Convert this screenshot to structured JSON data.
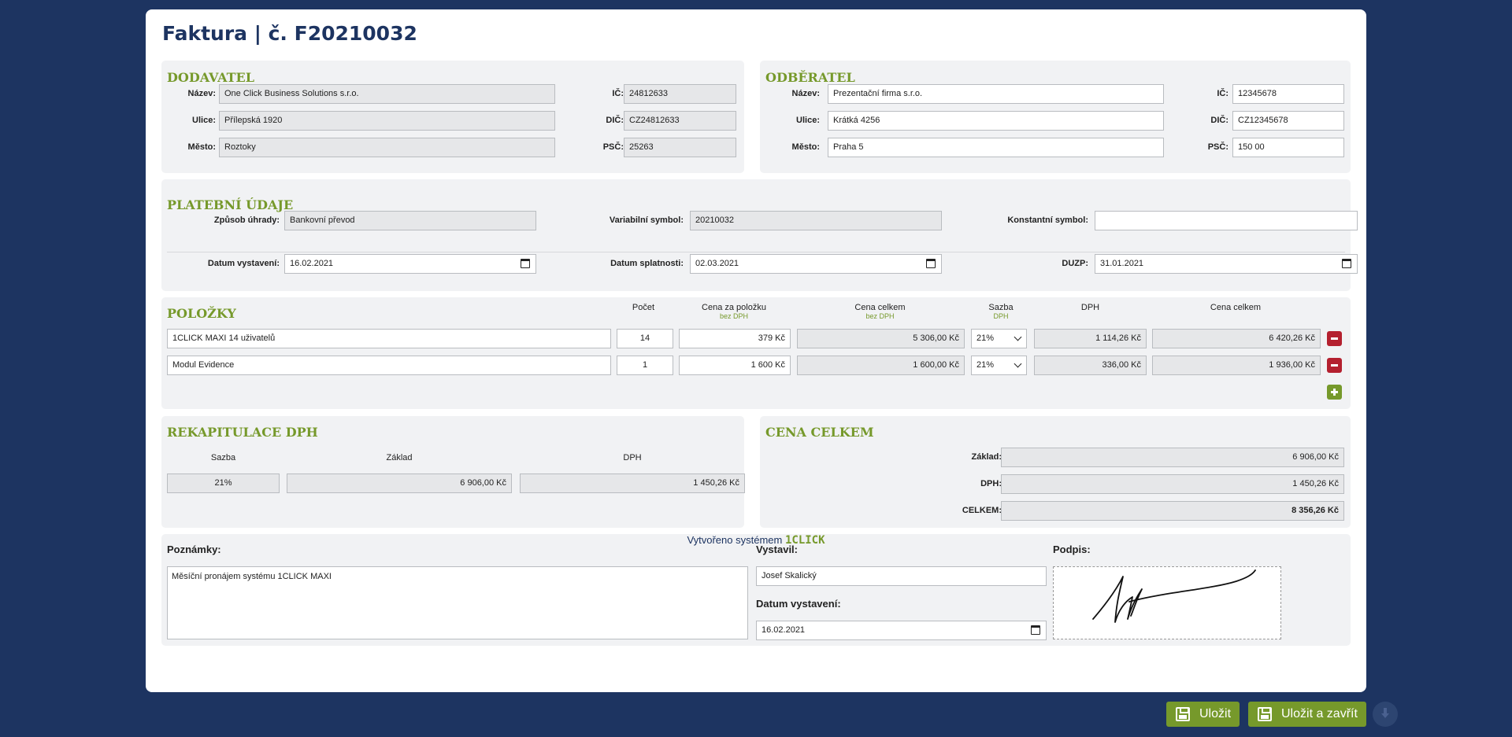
{
  "invoice": {
    "title": "Faktura | č. F20210032"
  },
  "supplier": {
    "heading": "DODAVATEL",
    "name_label": "Název:",
    "name": "One Click Business Solutions s.r.o.",
    "street_label": "Ulice:",
    "street": "Přílepská 1920",
    "city_label": "Město:",
    "city": "Roztoky",
    "ic_label": "IČ:",
    "ic": "24812633",
    "dic_label": "DIČ:",
    "dic": "CZ24812633",
    "psc_label": "PSČ:",
    "psc": "25263"
  },
  "customer": {
    "heading": "ODBĚRATEL",
    "name_label": "Název:",
    "name": "Prezentační firma s.r.o.",
    "street_label": "Ulice:",
    "street": "Krátká 4256",
    "city_label": "Město:",
    "city": "Praha 5",
    "ic_label": "IČ:",
    "ic": "12345678",
    "dic_label": "DIČ:",
    "dic": "CZ12345678",
    "psc_label": "PSČ:",
    "psc": "150 00"
  },
  "payment": {
    "heading": "PLATEBNÍ ÚDAJE",
    "method_label": "Způsob úhrady:",
    "method": "Bankovní převod",
    "vs_label": "Variabilní symbol:",
    "vs": "20210032",
    "ks_label": "Konstantní symbol:",
    "ks": "",
    "issue_label": "Datum vystavení:",
    "issue_date": "16.02.2021",
    "due_label": "Datum splatnosti:",
    "due_date": "02.03.2021",
    "duzp_label": "DUZP:",
    "duzp": "31.01.2021"
  },
  "items": {
    "heading": "POLOŽKY",
    "col_count": "Počet",
    "col_unit_price": "Cena za položku",
    "col_unit_price_sub": "bez DPH",
    "col_total_net": "Cena celkem",
    "col_total_net_sub": "bez DPH",
    "col_rate": "Sazba",
    "col_rate_sub": "DPH",
    "col_vat": "DPH",
    "col_total": "Cena celkem",
    "rows": [
      {
        "name": "1CLICK MAXI 14 uživatelů",
        "count": "14",
        "unit_price": "379 Kč",
        "total_net": "5 306,00 Kč",
        "rate": "21%",
        "vat": "1 114,26 Kč",
        "total": "6 420,26 Kč"
      },
      {
        "name": "Modul Evidence",
        "count": "1",
        "unit_price": "1 600 Kč",
        "total_net": "1 600,00 Kč",
        "rate": "21%",
        "vat": "336,00 Kč",
        "total": "1 936,00 Kč"
      }
    ]
  },
  "vat_summary": {
    "heading": "REKAPITULACE DPH",
    "col_rate": "Sazba",
    "col_base": "Základ",
    "col_vat": "DPH",
    "rate": "21%",
    "base": "6 906,00 Kč",
    "vat": "1 450,26 Kč"
  },
  "totals": {
    "heading": "CENA CELKEM",
    "base_label": "Základ:",
    "base": "6 906,00 Kč",
    "vat_label": "DPH:",
    "vat": "1 450,26 Kč",
    "total_label": "CELKEM:",
    "total": "8 356,26 Kč"
  },
  "notes": {
    "notes_label": "Poznámky:",
    "notes": "Měsíční pronájem systému 1CLICK MAXI",
    "issued_by_label": "Vystavil:",
    "issued_by": "Josef Skalický",
    "issued_date_label": "Datum vystavení:",
    "issued_date": "16.02.2021",
    "signature_label": "Podpis:"
  },
  "footer": {
    "text": "Vytvořeno systémem",
    "brand": "1CLICK"
  },
  "actions": {
    "save": "Uložit",
    "save_close": "Uložit a zavřít"
  },
  "colors": {
    "navy": "#1d3461",
    "green": "#76992b",
    "red": "#b4202f"
  }
}
